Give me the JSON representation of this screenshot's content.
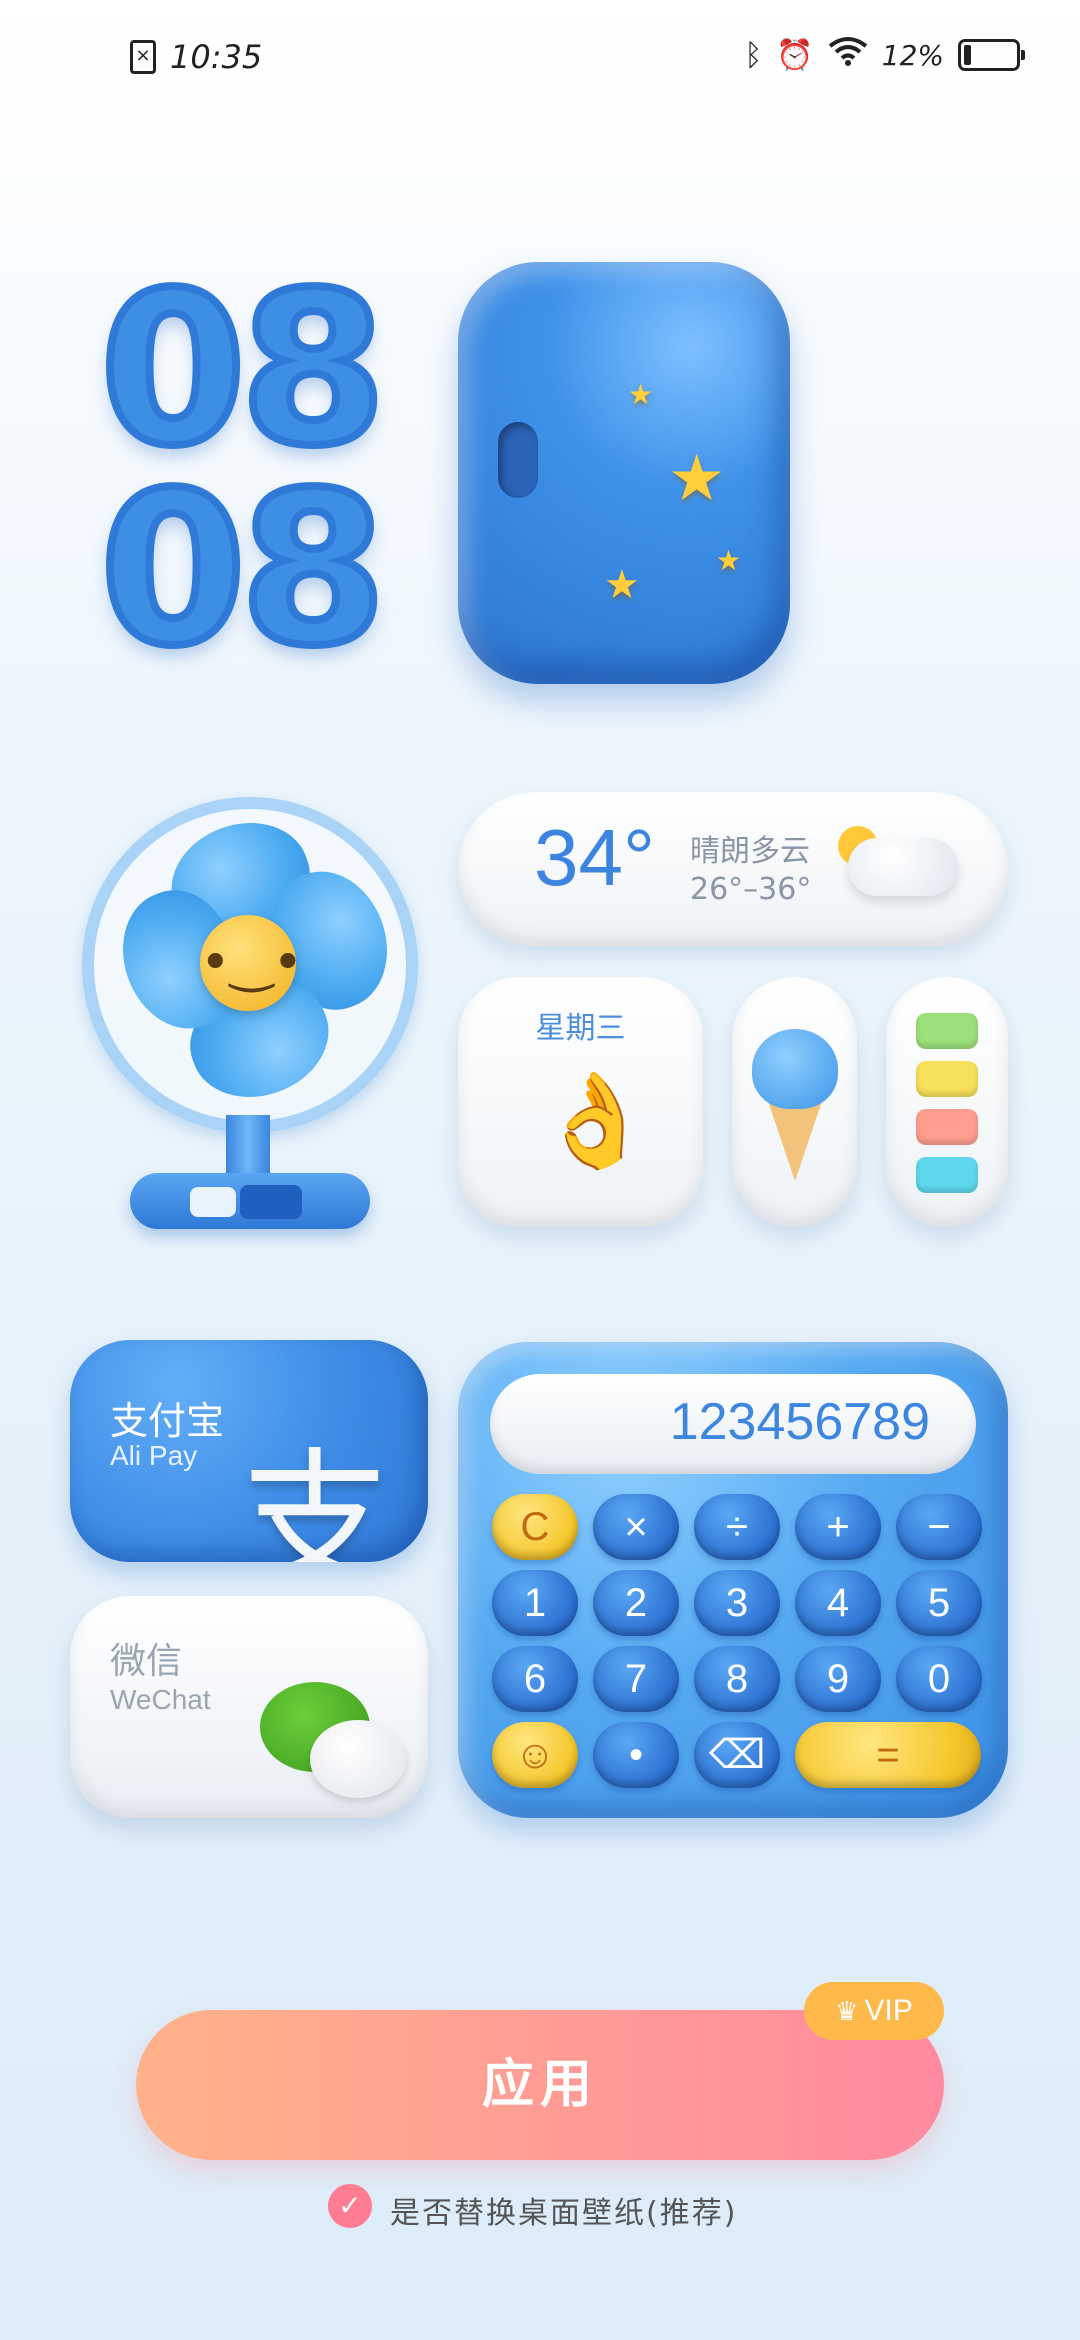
{
  "status_bar": {
    "time": "10:35",
    "battery": "12%",
    "icons": [
      "sim-error-icon",
      "bluetooth-icon",
      "alarm-icon",
      "wifi-icon",
      "battery-icon"
    ]
  },
  "clock": {
    "hour": "08",
    "minute": "08"
  },
  "weather": {
    "temp": "34°",
    "condition": "晴朗多云",
    "range": "26°–36°"
  },
  "day": {
    "weekday": "星期三"
  },
  "alipay": {
    "name": "支付宝",
    "english": "Ali Pay",
    "logo_char": "支"
  },
  "wechat": {
    "name": "微信",
    "english": "WeChat"
  },
  "calculator": {
    "display": "123456789",
    "rows": [
      [
        "C",
        "×",
        "÷",
        "+",
        "−"
      ],
      [
        "1",
        "2",
        "3",
        "4",
        "5"
      ],
      [
        "6",
        "7",
        "8",
        "9",
        "0"
      ],
      [
        "☺",
        "•",
        "⌫",
        "="
      ]
    ]
  },
  "apply_button": {
    "label": "应用",
    "badge": "VIP"
  },
  "replace_wallpaper": {
    "label": "是否替换桌面壁纸(推荐)",
    "checked": true
  },
  "colors": {
    "accent_blue": "#3d8fe6",
    "apply_gradient_start": "#ffb38a",
    "apply_gradient_end": "#ff8aa0",
    "vip": "#ffb84a"
  }
}
